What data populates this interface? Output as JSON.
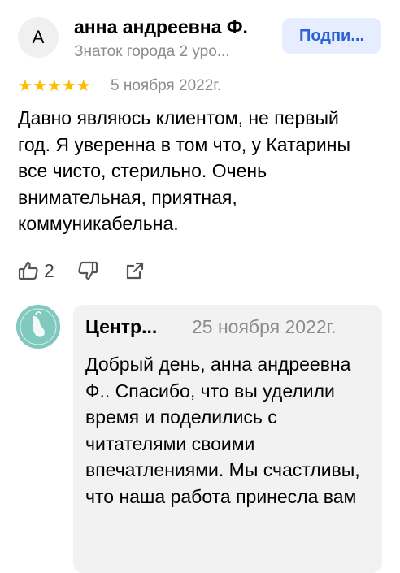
{
  "review": {
    "author": {
      "avatar_letter": "А",
      "name": "анна андреевна Ф.",
      "level": "Знаток города 2 уро..."
    },
    "subscribe_label": "Подпи...",
    "rating": 5,
    "rating_color": "#fcbd00",
    "date": "5 ноября 2022г.",
    "text": "Давно являюсь клиентом, не первый год. Я уверенна в том что, у Катарины все чисто, стерильно. Очень внимательная, приятная, коммуникабельна.",
    "likes": "2",
    "icons": [
      "thumbs-up-icon",
      "thumbs-down-icon",
      "share-icon"
    ]
  },
  "reply": {
    "name": "Центр...",
    "date": "25 ноября 2022г.",
    "text": "Добрый день, анна андреевна Ф.. Спасибо, что вы уделили время и поделились с читателями своими впечатлениями. Мы счастливы, что наша работа принесла вам"
  },
  "colors": {
    "accent": "#2b61d6",
    "accent_bg": "#e5edff",
    "muted": "#8c8c8c",
    "logo": "#7fc9bf"
  }
}
